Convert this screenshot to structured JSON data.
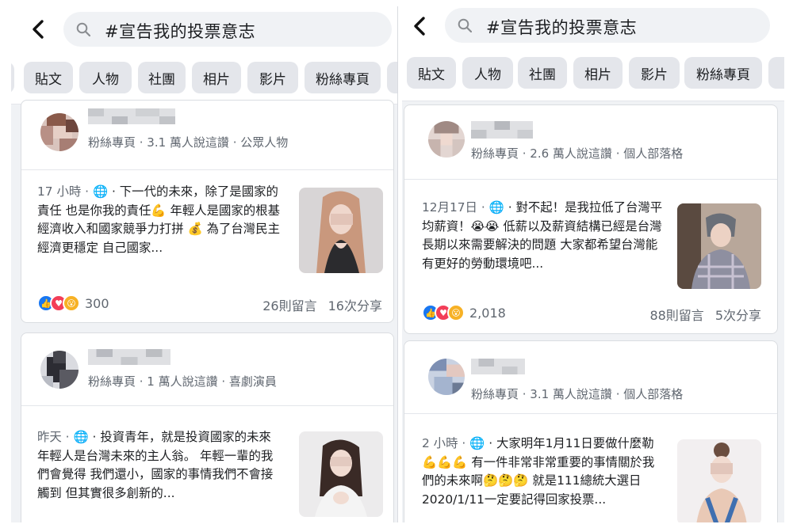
{
  "colors": {
    "accent": "#1877f2",
    "love": "#f33e58",
    "wow": "#f7b125",
    "chip_bg": "#e4e6eb",
    "meta_text": "#606770"
  },
  "icons": {
    "back": "chevron-left-icon",
    "search": "magnifier-icon",
    "globe": "globe-icon",
    "like": "thumbs-up-icon",
    "love": "heart-icon",
    "wow": "wow-face-icon"
  },
  "left": {
    "search": {
      "query": "#宣告我的投票意志"
    },
    "chips": [
      "貼文",
      "人物",
      "社團",
      "相片",
      "影片",
      "粉絲專頁"
    ],
    "posts": [
      {
        "meta": "粉絲專頁 · 3.1 萬人說這讚 · 公眾人物",
        "time": "17 小時 · ",
        "text": " · 下一代的未來，除了是國家的責任 也是你我的責任💪 年輕人是國家的根基 經濟收入和國家競爭力打拼 💰 為了台灣民主經濟更穩定 自己國家...",
        "reaction_count": "300",
        "comments": "26則留言",
        "shares": "16次分享"
      },
      {
        "meta": "粉絲專頁 · 1 萬人說這讚 · 喜劇演員",
        "time": "昨天 · ",
        "text": " · 投資青年，就是投資國家的未來 年輕人是台灣未來的主人翁。 年輕一輩的我們會覺得 我們還小，國家的事情我們不會接觸到 但其實很多創新的..."
      }
    ]
  },
  "right": {
    "search": {
      "query": "#宣告我的投票意志"
    },
    "chips": [
      "貼文",
      "人物",
      "社團",
      "相片",
      "影片",
      "粉絲專頁"
    ],
    "posts": [
      {
        "meta": "粉絲專頁 · 2.6 萬人說這讚 · 個人部落格",
        "time": "12月17日 · ",
        "text": " · 對不起！是我拉低了台灣平均薪資！😭😭 低薪以及薪資結構已經是台灣長期以來需要解決的問題 大家都希望台灣能有更好的勞動環境吧...",
        "reaction_count": "2,018",
        "comments": "88則留言",
        "shares": "5次分享"
      },
      {
        "meta": "粉絲專頁 · 3.1 萬人說這讚 · 個人部落格",
        "time": "2 小時 · ",
        "text": " · 大家明年1月11日要做什麼勒💪💪💪 有一件非常非常重要的事情關於我們的未來啊🤔🤔🤔 就是111總統大選日 2020/1/11一定要記得回家投票..."
      }
    ]
  }
}
